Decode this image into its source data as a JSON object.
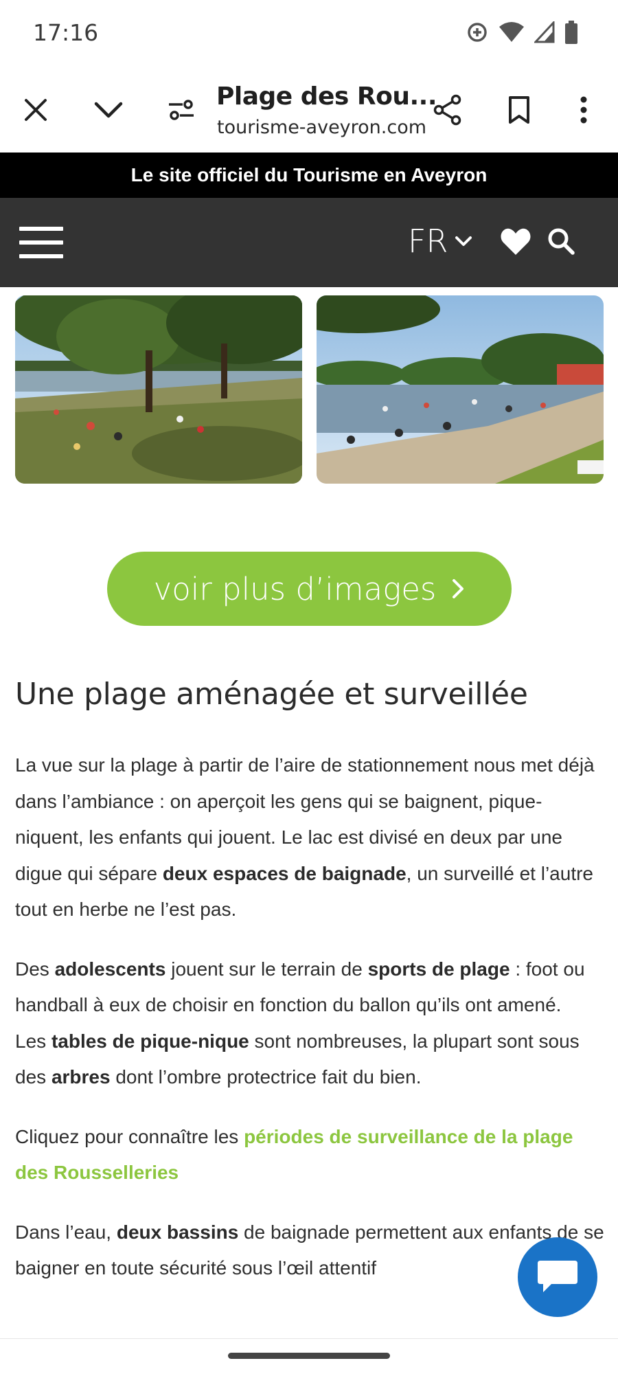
{
  "status_bar": {
    "time": "17:16",
    "icons": [
      "data-saver-icon",
      "wifi-icon",
      "cell-signal-icon",
      "battery-icon"
    ]
  },
  "toolbar": {
    "title": "Plage des Rou...",
    "url": "tourisme-aveyron.com",
    "icons": [
      "close-icon",
      "chevron-down-icon",
      "site-settings-icon",
      "share-icon",
      "bookmark-icon",
      "more-vert-icon"
    ]
  },
  "banner": {
    "text": "Le site officiel du Tourisme en Aveyron"
  },
  "site_nav": {
    "language": "FR",
    "icons": [
      "hamburger-menu-icon",
      "chevron-down-icon",
      "heart-icon",
      "search-icon"
    ]
  },
  "gallery": {
    "button_label": "voir plus d’images",
    "button_icon": "chevron-right-icon"
  },
  "article": {
    "title": "Une plage aménagée et surveillée",
    "p1": {
      "a": "La vue sur la plage à partir de l’aire de stationnement nous met déjà dans l’ambiance : on aperçoit les gens qui se baignent, pique-niquent, les enfants qui jouent. Le lac est divisé en deux par une digue qui sépare ",
      "b": "deux espaces de baignade",
      "c": ", un surveillé et l’autre tout en herbe ne l’est pas."
    },
    "p2": {
      "a": "Des ",
      "b": "adolescents",
      "c": " jouent sur le terrain de ",
      "d": "sports de plage",
      "e": " : foot ou handball à eux de choisir en fonction du ballon qu’ils ont amené.",
      "f": "Les ",
      "g": "tables de pique-nique",
      "h": " sont nombreuses, la plupart sont sous des ",
      "i": "arbres",
      "j": " dont l’ombre protectrice fait du bien."
    },
    "p3": {
      "a": "Cliquez pour connaître les ",
      "link": "périodes de surveillance de la plage des Rousselleries"
    },
    "p4": {
      "a": "Dans l’eau, ",
      "b": "deux bassins",
      "c": " de baignade permettent aux enfants de se baigner en toute sécurité sous l’œil attentif"
    }
  },
  "chat": {
    "icon": "chat-bubble-icon"
  },
  "colors": {
    "accent_green": "#8cc63f",
    "banner_bg": "#000000",
    "nav_bg": "#333333",
    "chat_blue": "#1a73c7"
  }
}
